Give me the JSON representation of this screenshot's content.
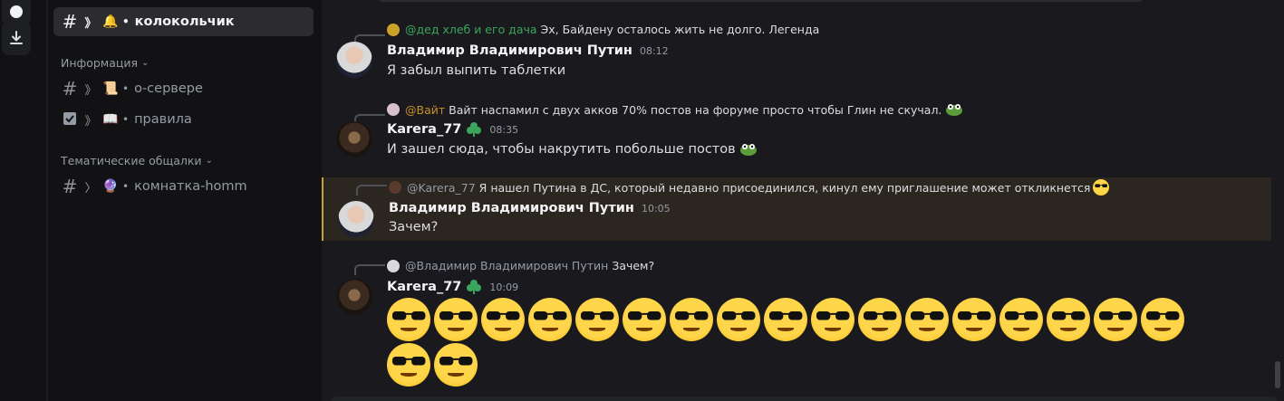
{
  "sidebar": {
    "active_channel": {
      "name": "колокольчик",
      "emoji": "🔔"
    },
    "categories": [
      {
        "label": "Информация",
        "channels": [
          {
            "name": "о-сервере",
            "emoji": "📜"
          },
          {
            "name": "правила",
            "emoji": "📖"
          }
        ]
      },
      {
        "label": "Тематические общалки",
        "channels": [
          {
            "name": "комнатка-homm",
            "emoji": "🔮"
          }
        ]
      }
    ]
  },
  "messages": [
    {
      "reply_author": "@дед хлеб и его дача",
      "reply_text": "Эх, Байдену осталось жить не долго. Легенда",
      "reply_color": "#3ba55d",
      "author": "Владимир Владимирович Путин",
      "time": "08:12",
      "text": "Я забыл выпить таблетки"
    },
    {
      "reply_author": "@Вайт",
      "reply_text": "Вайт наспамил с двух акков 70% постов на форуме просто чтобы Глин не скучал.",
      "reply_color": "#c69026",
      "author": "Karera_77",
      "time": "08:35",
      "text": "И зашел сюда, чтобы накрутить побольше постов"
    },
    {
      "reply_author": "@Karera_77",
      "reply_text": "Я нашел Путина в ДС, который недавно присоединился, кинул ему приглашение может откликнется",
      "reply_color": "#949ba4",
      "author": "Владимир Владимирович Путин",
      "time": "10:05",
      "text": "Зачем?"
    },
    {
      "reply_author": "@Владимир Владимирович Путин",
      "reply_text": "Зачем?",
      "reply_color": "#949ba4",
      "author": "Karera_77",
      "time": "10:09",
      "emoji_count": 19
    }
  ],
  "icons": {
    "download": "download-icon",
    "hash": "hash-icon",
    "sunglasses": "sunglasses-emoji"
  }
}
